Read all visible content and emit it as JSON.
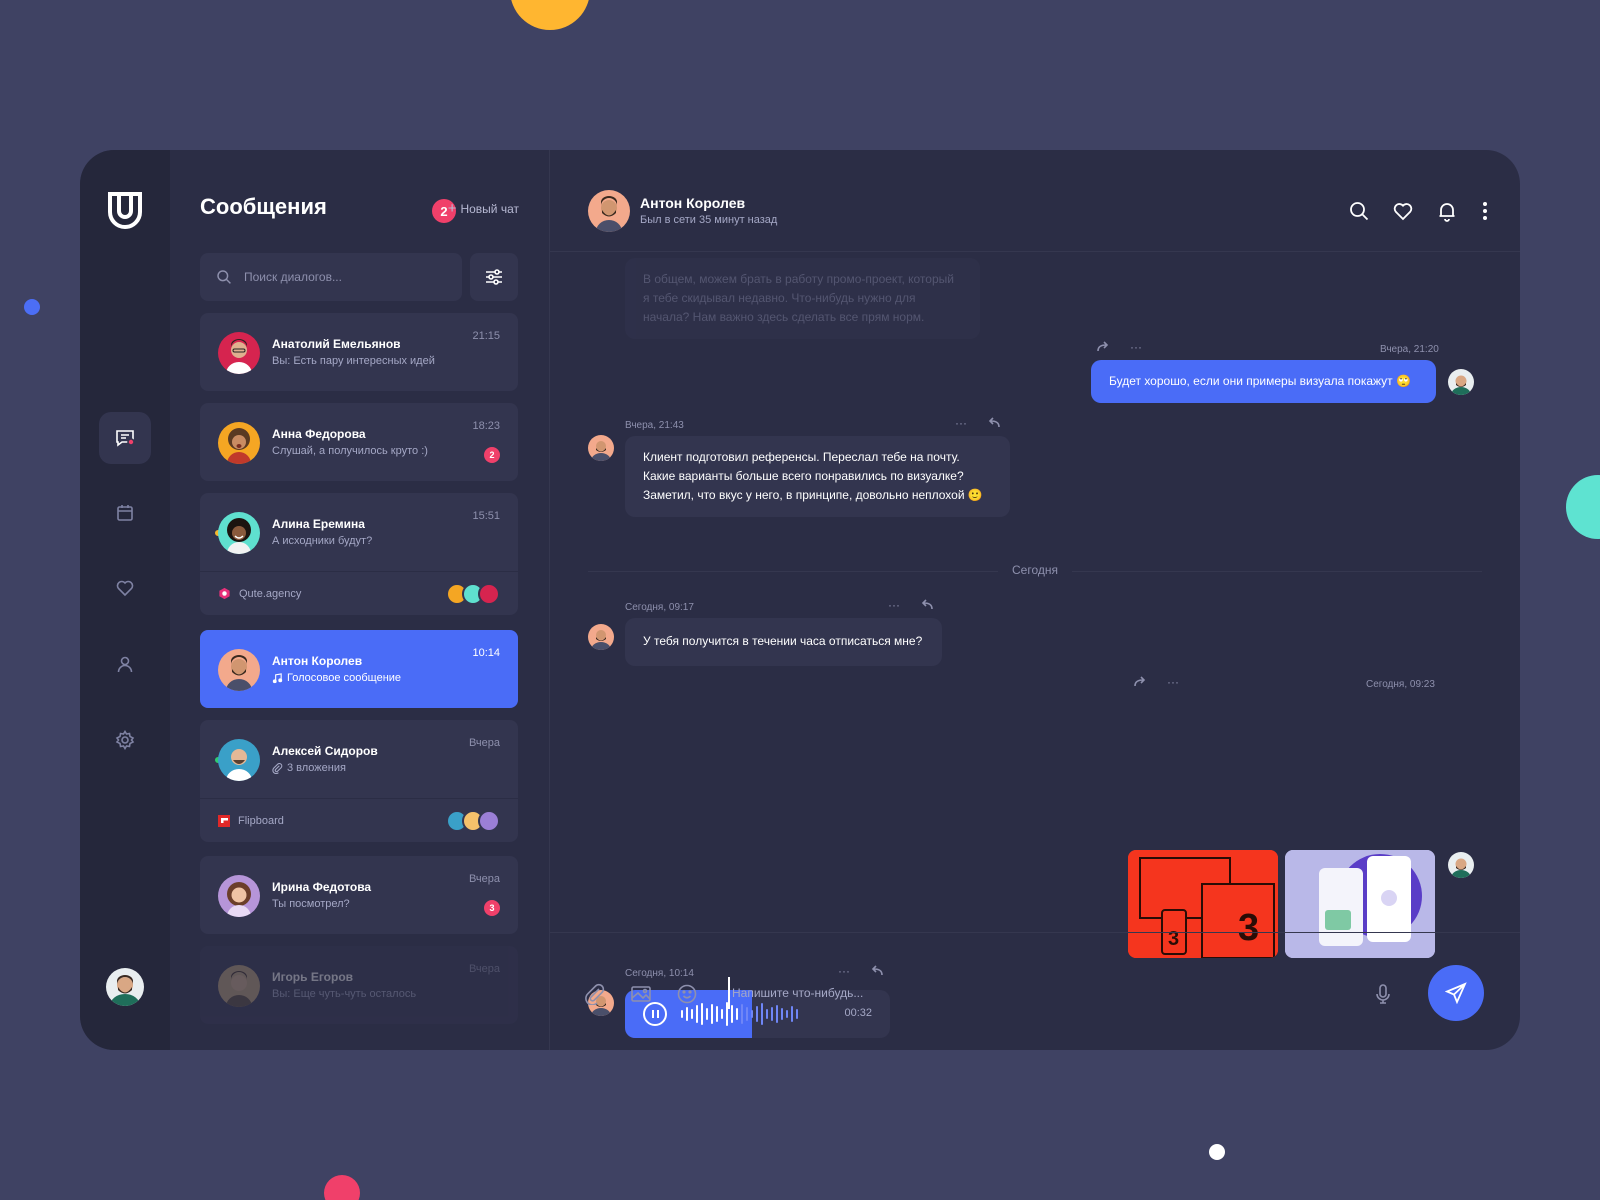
{
  "colors": {
    "background": "#3f4263",
    "panel": "#2b2d45",
    "card": "#33354f",
    "accent": "#4a6cf7",
    "badge": "#f0406a"
  },
  "sidebar": {
    "items": [
      {
        "icon": "chat-icon",
        "active": true
      },
      {
        "icon": "calendar-icon",
        "active": false
      },
      {
        "icon": "heart-icon",
        "active": false
      },
      {
        "icon": "user-icon",
        "active": false
      },
      {
        "icon": "gear-icon",
        "active": false
      }
    ]
  },
  "list": {
    "title": "Сообщения",
    "unread_count": "2",
    "new_chat_label": "Новый чат",
    "search_placeholder": "Поиск диалогов...",
    "chats": [
      {
        "name": "Анатолий Емельянов",
        "preview": "Вы: Есть пару интересных идей",
        "time": "21:15"
      },
      {
        "name": "Анна Федорова",
        "preview": "Слушай, а получилось круто :)",
        "time": "18:23",
        "badge": "2"
      },
      {
        "name": "Алина Еремина",
        "preview": "А исходники будут?",
        "time": "15:51",
        "group": "Qute.agency"
      },
      {
        "name": "Антон Королев",
        "preview": "Голосовое сообщение",
        "time": "10:14",
        "active": true
      },
      {
        "name": "Алексей Сидоров",
        "preview": "3 вложения",
        "time": "Вчера",
        "group": "Flipboard"
      },
      {
        "name": "Ирина Федотова",
        "preview": "Ты посмотрел?",
        "time": "Вчера",
        "badge": "3"
      },
      {
        "name": "Игорь Егоров",
        "preview": "Вы: Еще чуть-чуть осталось",
        "time": "Вчера"
      }
    ]
  },
  "chat": {
    "name": "Антон Королев",
    "status": "Был в сети 35 минут назад",
    "day_separator": "Сегодня",
    "composer_placeholder": "Напишите что-нибудь...",
    "messages": [
      {
        "text": "В общем, можем брать в работу промо-проект, который я тебе скидывал недавно. Что-нибудь нужно для начала? Нам важно здесь сделать все прям норм."
      },
      {
        "time": "Вчера, 21:20",
        "text": "Будет хорошо, если они примеры визуала покажут 🙄"
      },
      {
        "time": "Вчера, 21:43",
        "text": "Клиент подготовил референсы. Переслал тебе на почту. Какие варианты больше всего понравились по визуалке? Заметил, что вкус у него, в принципе, довольно неплохой 🙂"
      },
      {
        "time": "Сегодня, 09:17",
        "text": "У тебя получится в течении часа отписаться мне?"
      },
      {
        "time": "Сегодня, 09:23"
      },
      {
        "time": "Сегодня, 10:14",
        "duration": "00:32",
        "progress": 0.48
      }
    ]
  }
}
